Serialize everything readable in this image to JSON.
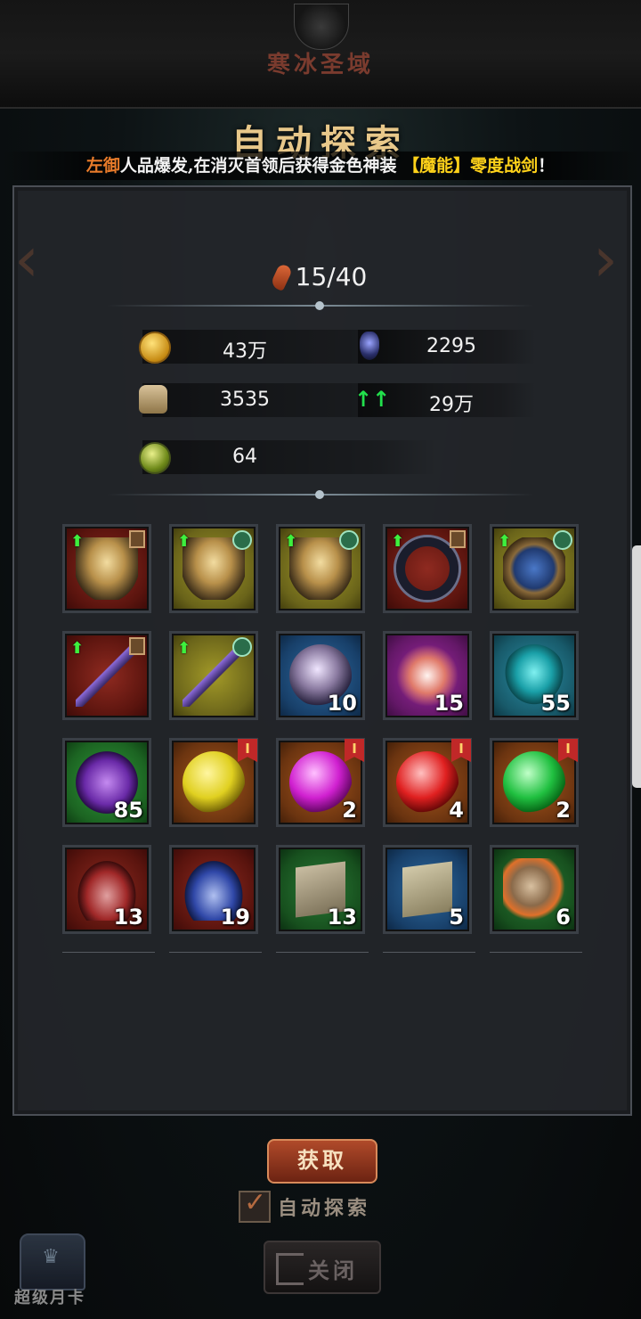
{
  "header": {
    "zone_title": "寒冰圣域",
    "panel_title": "自动探索"
  },
  "ticker": {
    "player": "左御",
    "text": "人品爆发,在消灭首领后获得金色神装",
    "item": "【魔能】零度战剑",
    "end": "！"
  },
  "stamina": {
    "icon": "drumstick-icon",
    "value": "15/40"
  },
  "resources": [
    {
      "icon": "gold-coin-icon",
      "value": "43万"
    },
    {
      "icon": "crystal-icon",
      "value": "2295"
    },
    {
      "icon": "pouch-icon",
      "value": "3535"
    },
    {
      "icon": "exp-up-arrows-icon",
      "value": "29万"
    },
    {
      "icon": "green-orb-icon",
      "value": "64"
    }
  ],
  "items": [
    {
      "name": "gold-armor-red",
      "bg": "red",
      "count": "",
      "badge": "lock",
      "upgrade": true
    },
    {
      "name": "gold-armor-yellow",
      "bg": "yellow",
      "count": "",
      "badge": "mark",
      "upgrade": true
    },
    {
      "name": "gold-armor-yellow-2",
      "bg": "yellow",
      "count": "",
      "badge": "mark",
      "upgrade": true
    },
    {
      "name": "dark-ring-red",
      "bg": "red",
      "count": "",
      "badge": "lock",
      "upgrade": true
    },
    {
      "name": "rune-shield-yellow",
      "bg": "yellow",
      "count": "",
      "badge": "mark",
      "upgrade": true
    },
    {
      "name": "sword-red",
      "bg": "red",
      "count": "",
      "badge": "lock",
      "upgrade": true
    },
    {
      "name": "sword-yellow",
      "bg": "yellow",
      "count": "",
      "badge": "mark",
      "upgrade": true
    },
    {
      "name": "eye-orb",
      "bg": "blue",
      "count": "10",
      "badge": "",
      "upgrade": false
    },
    {
      "name": "magic-crystal",
      "bg": "purple",
      "count": "15",
      "badge": "",
      "upgrade": false
    },
    {
      "name": "teal-gem",
      "bg": "teal",
      "count": "55",
      "badge": "",
      "upgrade": false
    },
    {
      "name": "dragon-scale",
      "bg": "green",
      "count": "85",
      "badge": "",
      "upgrade": false
    },
    {
      "name": "yellow-gem",
      "bg": "orange",
      "count": "",
      "badge": "rank",
      "upgrade": false
    },
    {
      "name": "purple-gem",
      "bg": "orange",
      "count": "2",
      "badge": "rank",
      "upgrade": false
    },
    {
      "name": "red-gem",
      "bg": "orange",
      "count": "4",
      "badge": "rank",
      "upgrade": false
    },
    {
      "name": "green-gem",
      "bg": "orange",
      "count": "2",
      "badge": "rank",
      "upgrade": false
    },
    {
      "name": "red-potion",
      "bg": "red",
      "count": "13",
      "badge": "",
      "upgrade": false
    },
    {
      "name": "blue-potion",
      "bg": "red",
      "count": "19",
      "badge": "",
      "upgrade": false
    },
    {
      "name": "rune-scroll-green",
      "bg": "darkgreen",
      "count": "13",
      "badge": "",
      "upgrade": false
    },
    {
      "name": "rune-scroll-blue",
      "bg": "blue",
      "count": "5",
      "badge": "",
      "upgrade": false
    },
    {
      "name": "flaming-ore",
      "bg": "darkgreen",
      "count": "6",
      "badge": "",
      "upgrade": false
    }
  ],
  "rank_label": "I",
  "buttons": {
    "get": "获取",
    "auto_explore": "自动探索",
    "close": "关闭"
  },
  "month_card": "超级月卡"
}
